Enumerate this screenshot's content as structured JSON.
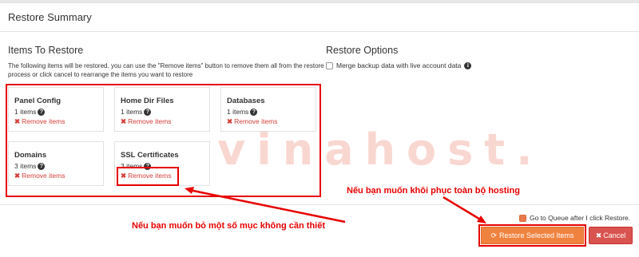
{
  "dialog": {
    "title": "Restore Summary"
  },
  "items_section": {
    "title": "Items To Restore",
    "description": "The following items will be restored. you can use the \"Remove items\" button to remove them all from the restore process or click cancel to rearrange the items you want to restore",
    "cards": [
      {
        "name": "Panel Config",
        "count": "1 items",
        "remove_label": "Remove items"
      },
      {
        "name": "Home Dir Files",
        "count": "1 items",
        "remove_label": "Remove items"
      },
      {
        "name": "Databases",
        "count": "1 items",
        "remove_label": "Remove items"
      },
      {
        "name": "Domains",
        "count": "3 items",
        "remove_label": "Remove items"
      },
      {
        "name": "SSL Certificates",
        "count": "3 items",
        "remove_label": "Remove items"
      }
    ]
  },
  "options_section": {
    "title": "Restore Options",
    "merge_label": "Merge backup data with live account data",
    "merge_checked": false
  },
  "footer": {
    "queue_label": "Go to Queue after I click Restore.",
    "queue_checked": true,
    "restore_button": "Restore Selected Items",
    "cancel_button": "Cancel"
  },
  "annotations": {
    "restore_all": "Nếu bạn muốn khôi phục toàn bộ hosting",
    "remove_some": "Nếu bạn muốn bỏ một số mục không cần thiết"
  },
  "watermark": {
    "text": "vinahost."
  },
  "colors": {
    "accent_orange": "#f0823f",
    "danger_red": "#d9534f",
    "annotation_red": "#e60000"
  }
}
